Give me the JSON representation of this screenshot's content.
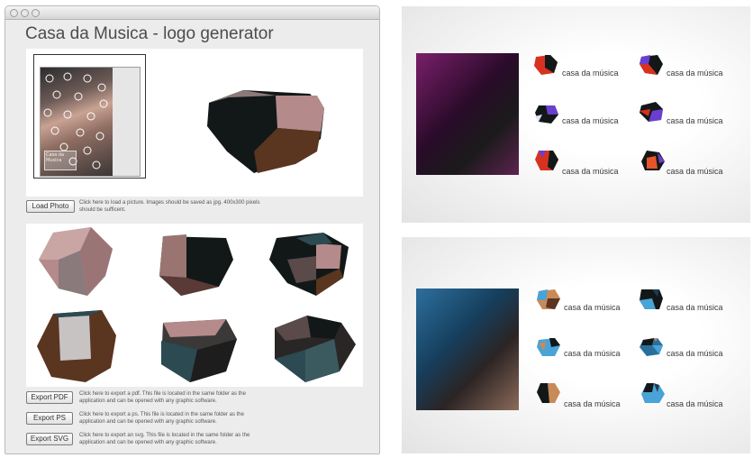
{
  "app": {
    "title": "Casa da Musica - logo generator",
    "photo_caption": "Casa da Musica"
  },
  "load": {
    "button_label": "Load Photo",
    "help": "Click here to load a picture. Images should be saved as jpg. 400x300 pixels should be sufficent."
  },
  "exports": [
    {
      "label": "Export PDF",
      "help": "Click here to export a pdf. This file is located in the same folder as the application and can be opened with any graphic software."
    },
    {
      "label": "Export PS",
      "help": "Click here to export a ps. This file is located in the same folder as the application and can be opened with any graphic software."
    },
    {
      "label": "Export SVG",
      "help": "Click here to export an svg. This file is located in the same folder as the application and can be opened with any graphic software."
    }
  ],
  "brand": {
    "name": "casa da música"
  },
  "colors": {
    "window_bg": "#ececec",
    "shape_dark": "#121818",
    "shape_pink": "#b48a8a",
    "shape_brown": "#5a3520",
    "shape_teal": "#2b4a52",
    "red": "#d8311f",
    "purple": "#6a3fd0",
    "blue": "#4aa3d6",
    "tan": "#c98a5a"
  }
}
